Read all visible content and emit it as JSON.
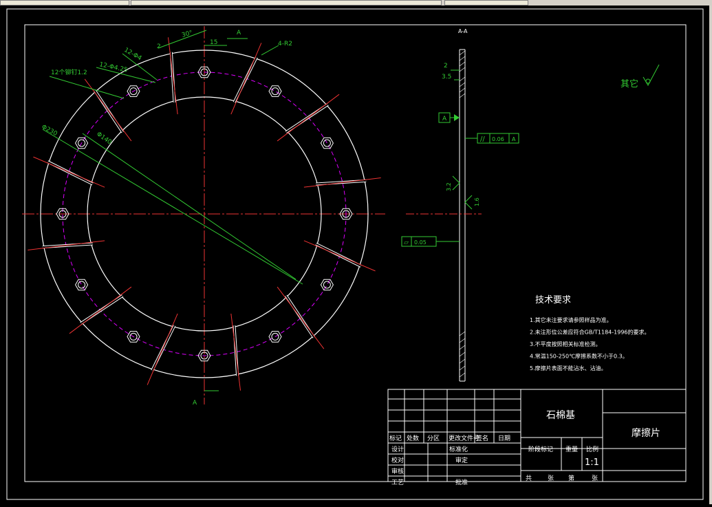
{
  "drawing": {
    "section_label": "A-A",
    "view_marker": "A",
    "other_roughness": "其它",
    "tech_title": "技术要求",
    "tech_notes": [
      "1.其它未注要求请参照样品为准。",
      "2.未注形位公差应符合GB/T1184-1996的要求。",
      "3.不平度按照相关标准检测。",
      "4.常温150-250℃摩擦系数不小于0.3。",
      "5.摩擦片表面不能沾水、沾油。"
    ],
    "dims": {
      "d230": "Φ230",
      "d140": "Φ140",
      "holes": "12个铆钉1.2",
      "counterbore": "12-Φ4.25",
      "hole2": "12-Φ4",
      "angle": "30°",
      "w15": "15",
      "grooves": "4-R2",
      "two": "2",
      "t35": "3.5",
      "n2": "2",
      "flat": "0.05",
      "parallel": "0.06",
      "datum": "A",
      "rough_left": "3.2",
      "rough_right": "1.6"
    },
    "title_block": {
      "material": "石棉基",
      "part_name": "摩擦片",
      "scale": "1:1",
      "headers": [
        "标记",
        "处数",
        "分区",
        "更改文件号",
        "签名",
        "日期"
      ],
      "rows_left": [
        "设计",
        "校对",
        "审核",
        "工艺"
      ],
      "std_label": "标准化",
      "review_label": "审定",
      "approve_label": "批准",
      "stage_label": "阶段标记",
      "weight_label": "重量",
      "scale_label": "比例",
      "sheet_labels": [
        "共",
        "张",
        "第",
        "张"
      ]
    }
  }
}
